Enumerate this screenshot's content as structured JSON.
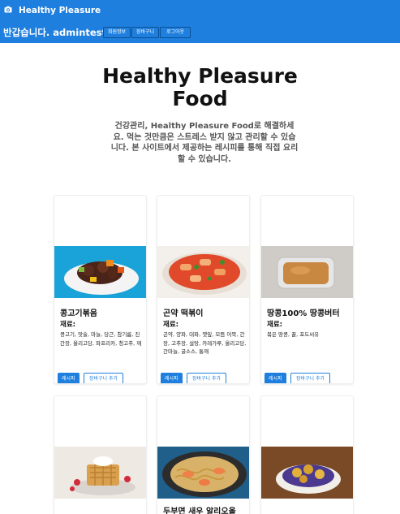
{
  "navbar": {
    "brand": "Healthy Pleasure",
    "welcome": "반갑습니다. admintest님",
    "buttons": [
      "회원정보",
      "장바구니",
      "로그아웃"
    ],
    "color": "#1f7fde"
  },
  "hero": {
    "title_line1": "Healthy Pleasure",
    "title_line2": "Food",
    "subtitle": "건강관리, Healthy Pleasure Food로 해결하세요. 먹는 것만큼은 스트레스 받지 않고 관리할 수 있습니다. 본 사이트에서 제공하는 레시피를 통해 직접 요리할 수 있습니다."
  },
  "cards": [
    {
      "name": "콩고기볶음",
      "ingredients_label": "재료:",
      "ingredients": "콩고기, 맛술, 마늘, 당근, 참기름, 진간장, 올리고당, 파프리카, 청고추, 깨",
      "recipe_button": "레시피",
      "cart_button": "장바구니 추가",
      "image_icon": "stir-fry-image"
    },
    {
      "name": "곤약 떡볶이",
      "ingredients_label": "재료:",
      "ingredients": "곤약, 양파, 대파, 깻잎, 모듬 어묵, 간장, 고추장, 설탕, 카레가루, 올리고당, 간마늘, 굴소스, 통깨",
      "recipe_button": "레시피",
      "cart_button": "장바구니 추가",
      "image_icon": "tteokbokki-image"
    },
    {
      "name": "땅콩100% 땅콩버터",
      "ingredients_label": "재료:",
      "ingredients": "볶은 땅콩, 꿀, 포도씨유",
      "recipe_button": "레시피",
      "cart_button": "장바구니 추가",
      "image_icon": "peanut-butter-image"
    },
    {
      "image_icon": "waffle-image"
    },
    {
      "name": "두부면 새우 알리오올",
      "image_icon": "shrimp-pasta-image"
    },
    {
      "image_icon": "dessert-bowl-image"
    }
  ]
}
